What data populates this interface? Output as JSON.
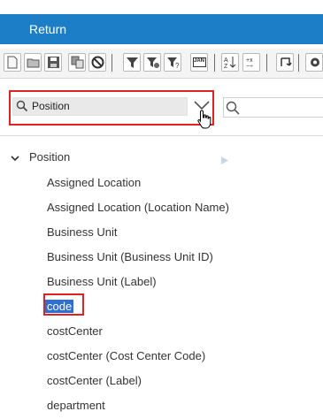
{
  "header": {
    "title": "Return"
  },
  "toolbar": {
    "buttons": [
      "new-icon",
      "open-icon",
      "save-icon",
      "copy-icon",
      "cancel-icon",
      "filter-icon",
      "filter-settings-icon",
      "filter-help-icon",
      "jan-icon",
      "sort-icon",
      "calculate-icon",
      "refresh-icon",
      "settings-icon"
    ],
    "jan_label": "JAN"
  },
  "field_dropdown": {
    "value": "Position"
  },
  "search": {
    "placeholder": ""
  },
  "tree": {
    "parent": "Position",
    "items": [
      "Assigned Location",
      "Assigned Location (Location Name)",
      "Business Unit",
      "Business Unit (Business Unit ID)",
      "Business Unit (Label)",
      "code",
      "costCenter",
      "costCenter (Cost Center Code)",
      "costCenter (Label)",
      "department"
    ],
    "selected_index": 5
  },
  "colors": {
    "accent": "#1b7ec6",
    "highlight_outline": "#e02222",
    "selection": "#2f6fd1"
  }
}
